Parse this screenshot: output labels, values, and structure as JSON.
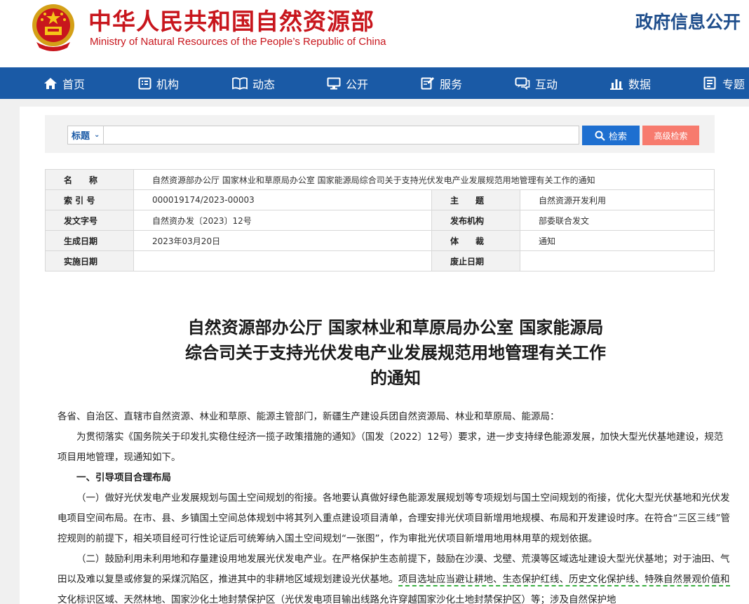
{
  "header": {
    "site_name_cn": "中华人民共和国自然资源部",
    "site_name_en": "Ministry of Natural Resources of the People’s Republic of China",
    "section_title": "政府信息公开"
  },
  "nav": {
    "items": [
      {
        "label": "首页",
        "icon": "home-icon"
      },
      {
        "label": "机构",
        "icon": "org-icon"
      },
      {
        "label": "动态",
        "icon": "book-icon"
      },
      {
        "label": "公开",
        "icon": "monitor-icon"
      },
      {
        "label": "服务",
        "icon": "edit-icon"
      },
      {
        "label": "互动",
        "icon": "chat-icon"
      },
      {
        "label": "数据",
        "icon": "bar-chart-icon"
      },
      {
        "label": "专题",
        "icon": "topic-icon"
      }
    ]
  },
  "search": {
    "field_selected": "标题",
    "input_value": "",
    "search_label": "检索",
    "advanced_label": "高级检索"
  },
  "meta": {
    "name_label": "名　　称",
    "name_value": "自然资源部办公厅 国家林业和草原局办公室 国家能源局综合司关于支持光伏发电产业发展规范用地管理有关工作的通知",
    "index_label": "索 引 号",
    "index_value": "000019174/2023-00003",
    "subject_label": "主　　题",
    "subject_value": "自然资源开发利用",
    "docno_label": "发文字号",
    "docno_value": "自然资办发〔2023〕12号",
    "issuer_label": "发布机构",
    "issuer_value": "部委联合发文",
    "date_label": "生成日期",
    "date_value": "2023年03月20日",
    "genre_label": "体　　裁",
    "genre_value": "通知",
    "effective_label": "实施日期",
    "effective_value": "",
    "expiry_label": "废止日期",
    "expiry_value": ""
  },
  "article": {
    "title_line1": "自然资源部办公厅 国家林业和草原局办公室 国家能源局",
    "title_line2": "综合司关于支持光伏发电产业发展规范用地管理有关工作",
    "title_line3": "的通知",
    "salutation": "各省、自治区、直辖市自然资源、林业和草原、能源主管部门，新疆生产建设兵团自然资源局、林业和草原局、能源局：",
    "intro": "为贯彻落实《国务院关于印发扎实稳住经济一揽子政策措施的通知》（国发〔2022〕12号）要求，进一步支持绿色能源发展，加快大型光伏基地建设，规范项目用地管理，现通知如下。",
    "section1_heading": "一、引导项目合理布局",
    "para1": "（一）做好光伏发电产业发展规划与国土空间规划的衔接。各地要认真做好绿色能源发展规划等专项规划与国土空间规划的衔接，优化大型光伏基地和光伏发电项目空间布局。在市、县、乡镇国土空间总体规划中将其列入重点建设项目清单，合理安排光伏项目新增用地规模、布局和开发建设时序。在符合“三区三线”管控规则的前提下，相关项目经可行性论证后可统筹纳入国土空间规划“一张图”，作为审批光伏项目新增用地用林用草的规划依据。",
    "para2_start": "（二）鼓励利用未利用地和存量建设用地发展光伏发电产业。在严格保护生态前提下，鼓励在沙漠、戈壁、荒漠等区域选址建设大型光伏基地；对于油田、气田以及难以复垦或修复的采煤沉陷区，推进其中的非耕地区域规划建设光伏基地。",
    "para2_highlight": "项目选址应当避让耕地、生态保护红线、历史文化保护线、特殊自然景观价值和文化标识区域、天然林地、国家沙化土地封禁保护区（光伏发电项目输出线路允许穿越国家沙化土地封禁保护区）",
    "para2_end": "等；涉及自然保护地"
  }
}
